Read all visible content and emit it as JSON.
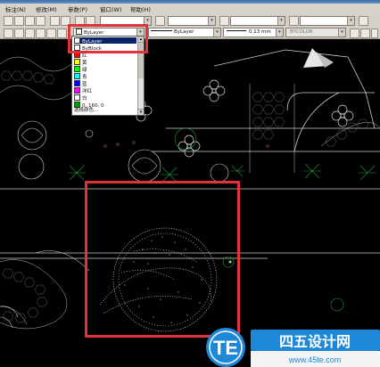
{
  "menu": [
    "标注(N)",
    "修改(M)",
    "参数(P)",
    "窗口(W)",
    "帮助(H)"
  ],
  "layer_combo": {
    "value": "ByLayer"
  },
  "linetype_combo": {
    "value": "ByLayer"
  },
  "lineweight_combo": {
    "value": "0.13 mm"
  },
  "plotstyle_combo": {
    "value": "BYCOLOR"
  },
  "color_dropdown": {
    "items": [
      {
        "label": "ByLayer",
        "color": "#ffffff",
        "selected": true
      },
      {
        "label": "ByBlock",
        "color": "#ffffff",
        "selected": false
      },
      {
        "label": "红",
        "color": "#ff0000",
        "selected": false
      },
      {
        "label": "黄",
        "color": "#ffff00",
        "selected": false
      },
      {
        "label": "绿",
        "color": "#00ff00",
        "selected": false
      },
      {
        "label": "青",
        "color": "#00ffff",
        "selected": false
      },
      {
        "label": "蓝",
        "color": "#0000ff",
        "selected": false
      },
      {
        "label": "洋红",
        "color": "#ff00ff",
        "selected": false
      },
      {
        "label": "白",
        "color": "#ffffff",
        "selected": false
      },
      {
        "label": "0, 160, 0",
        "color": "#00a000",
        "selected": false
      },
      {
        "label": "选择颜色...",
        "color": "",
        "selected": false
      }
    ]
  },
  "watermark": {
    "badge": "TE",
    "brand": "四五设计网",
    "url": "www.45te.com"
  },
  "colors": {
    "highlight": "#e0343a",
    "brand_blue": "#1e88d8",
    "canvas": "#000000"
  }
}
